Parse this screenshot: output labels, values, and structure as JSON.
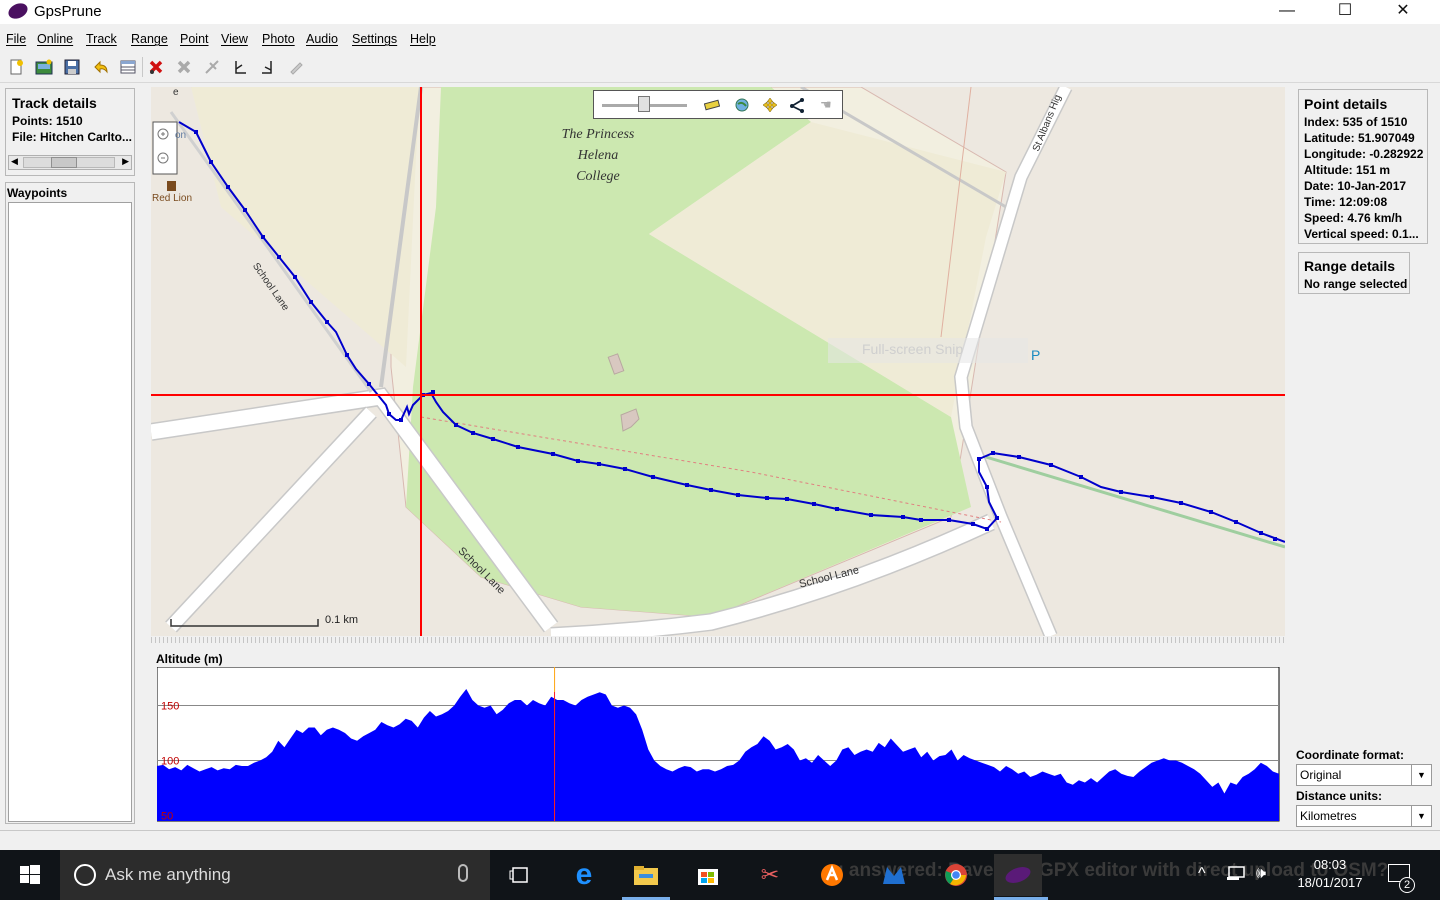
{
  "window": {
    "title": "GpsPrune",
    "minimize_glyph": "—",
    "maximize_glyph": "☐",
    "close_glyph": "✕"
  },
  "menu": [
    "File",
    "Online",
    "Track",
    "Range",
    "Point",
    "View",
    "Photo",
    "Audio",
    "Settings",
    "Help"
  ],
  "toolbar_icons": [
    "new-file-icon",
    "open-photo-icon",
    "save-icon",
    "undo-icon",
    "table-icon",
    "delete-point-icon",
    "delete-range-icon",
    "crop-icon",
    "set-range-start-icon",
    "set-range-end-icon",
    "edit-point-icon"
  ],
  "track_details": {
    "title": "Track details",
    "points": "Points: 1510",
    "file": "File: Hitchen Carlto..."
  },
  "waypoints": {
    "title": "Waypoints"
  },
  "map": {
    "labels": {
      "college_1": "The Princess",
      "college_2": "Helena",
      "college_3": "College",
      "red_lion": "Red Lion",
      "school_lane_diag": "School Lane",
      "school_lane_curve": "School Lane",
      "school_lane_bottom": "School Lane",
      "st_albans": "St Albans Hig",
      "parking": "P",
      "fullscreen_hint": "Full-screen Snip",
      "scale": "0.1 km",
      "pub_fragment": "on",
      "edge_fragment": "e"
    },
    "colors": {
      "track": "#0000cc",
      "crosshair": "#ff0000",
      "park": "#cce8b0",
      "land": "#ede8e0",
      "road": "#ffffff"
    }
  },
  "point_details": {
    "title": "Point details",
    "index": "Index: 535 of 1510",
    "latitude": "Latitude: 51.907049",
    "longitude": "Longitude: -0.282922",
    "altitude": "Altitude: 151 m",
    "date": "Date: 10-Jan-2017",
    "time": "Time: 12:09:08",
    "speed": "Speed: 4.76 km/h",
    "vertical_speed": "Vertical speed: 0.1..."
  },
  "range_details": {
    "title": "Range details",
    "status": "No range selected"
  },
  "coordinate_format": {
    "label": "Coordinate format:",
    "value": "Original"
  },
  "distance_units": {
    "label": "Distance units:",
    "value": "Kilometres"
  },
  "chart_data": {
    "type": "area",
    "title": "Altitude (m)",
    "y_ticks": [
      "150",
      "100",
      "50"
    ],
    "ylim": [
      45,
      185
    ],
    "x": "point index 0–1510",
    "selected_index": 535,
    "series": [
      {
        "values": [
          95,
          96,
          92,
          94,
          91,
          96,
          93,
          90,
          92,
          94,
          91,
          93,
          92,
          96,
          95,
          95,
          98,
          100,
          103,
          108,
          118,
          112,
          120,
          128,
          125,
          130,
          130,
          123,
          128,
          130,
          128,
          125,
          120,
          118,
          122,
          125,
          128,
          135,
          132,
          130,
          133,
          138,
          136,
          130,
          139,
          145,
          140,
          142,
          145,
          150,
          158,
          165,
          155,
          150,
          148,
          150,
          142,
          146,
          152,
          155,
          155,
          150,
          155,
          152,
          150,
          158,
          155,
          155,
          152,
          150,
          155,
          158,
          160,
          162,
          160,
          150,
          148,
          150,
          148,
          142,
          128,
          110,
          100,
          95,
          92,
          90,
          93,
          95,
          94,
          90,
          92,
          92,
          90,
          92,
          95,
          96,
          100,
          108,
          112,
          115,
          122,
          118,
          110,
          112,
          115,
          110,
          100,
          102,
          98,
          105,
          100,
          95,
          100,
          110,
          112,
          105,
          108,
          110,
          108,
          116,
          112,
          120,
          114,
          108,
          110,
          112,
          103,
          108,
          100,
          104,
          105,
          110,
          100,
          105,
          102,
          100,
          98,
          96,
          94,
          90,
          95,
          92,
          88,
          90,
          85,
          87,
          90,
          88,
          86,
          88,
          80,
          78,
          82,
          80,
          84,
          80,
          85,
          90,
          92,
          88,
          86,
          85,
          90,
          94,
          98,
          100,
          102,
          100,
          100,
          98,
          95,
          92,
          88,
          82,
          76,
          80,
          70,
          80,
          78,
          85,
          88,
          92,
          98,
          95,
          90,
          88
        ]
      }
    ]
  },
  "taskbar": {
    "search_placeholder": "Ask me anything",
    "time": "08:03",
    "date": "18/01/2017",
    "notification_count": "2",
    "background_text": "u answered: Davebom GPX editor with direct upload to OSM?"
  }
}
